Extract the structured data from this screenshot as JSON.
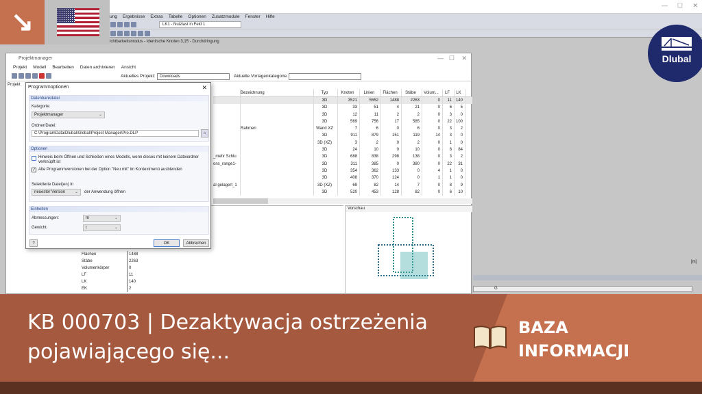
{
  "app": {
    "menu": [
      "ung",
      "Ergebnisse",
      "Extras",
      "Tabelle",
      "Optionen",
      "Zusatzmodule",
      "Fenster",
      "Hilfe"
    ],
    "load_case": "LK1 - Nutzlast in Feld 1",
    "status": "ichtbarkeitsmodus - Identische Knoten 3,15 - Durchdringung",
    "unit": "[m]",
    "bottom_tab": "G"
  },
  "pm": {
    "title": "Projektmanager",
    "menu": [
      "Projekt",
      "Modell",
      "Bearbeiten",
      "Daten archivieren",
      "Ansicht"
    ],
    "current_project_label": "Aktuelles Projekt:",
    "current_project": "Downloads",
    "template_label": "Aktuelle Vorlagenkategorie",
    "template_value": "",
    "left_tab": "Projekt",
    "table": {
      "headers": [
        "",
        "Bezeichnung",
        "Typ",
        "Knoten",
        "Linien",
        "Flächen",
        "Stäbe",
        "Volum...",
        "LF",
        "LK"
      ],
      "rows": [
        [
          "",
          "",
          "3D",
          "3521",
          "5552",
          "1488",
          "2263",
          "0",
          "11",
          "140"
        ],
        [
          "",
          "",
          "3D",
          "33",
          "51",
          "4",
          "21",
          "0",
          "6",
          "5"
        ],
        [
          "",
          "",
          "3D",
          "12",
          "11",
          "2",
          "2",
          "0",
          "3",
          "0"
        ],
        [
          "",
          "",
          "3D",
          "569",
          "756",
          "17",
          "585",
          "0",
          "22",
          "100"
        ],
        [
          "",
          "Rahmen",
          "Wand XZ",
          "7",
          "6",
          "0",
          "6",
          "0",
          "3",
          "2"
        ],
        [
          "",
          "",
          "3D",
          "911",
          "879",
          "151",
          "119",
          "14",
          "3",
          "0"
        ],
        [
          "",
          "",
          "3D (XZ)",
          "3",
          "2",
          "0",
          "2",
          "0",
          "1",
          "0"
        ],
        [
          "",
          "",
          "3D",
          "24",
          "10",
          "0",
          "10",
          "0",
          "8",
          "84"
        ],
        [
          "_mehr Schlu",
          "",
          "3D",
          "688",
          "838",
          "298",
          "138",
          "0",
          "3",
          "2"
        ],
        [
          "ons_range1-",
          "",
          "3D",
          "311",
          "385",
          "0",
          "380",
          "0",
          "22",
          "31"
        ],
        [
          "",
          "",
          "3D",
          "354",
          "362",
          "133",
          "0",
          "4",
          "1",
          "0"
        ],
        [
          "",
          "",
          "3D",
          "408",
          "370",
          "124",
          "0",
          "1",
          "1",
          "0"
        ],
        [
          "al gelagert_1",
          "",
          "3D (XZ)",
          "69",
          "82",
          "14",
          "7",
          "0",
          "8",
          "9"
        ],
        [
          "",
          "",
          "3D",
          "520",
          "453",
          "128",
          "82",
          "0",
          "6",
          "10"
        ]
      ]
    },
    "info": [
      [
        "Flächen",
        "1488"
      ],
      [
        "Stäbe",
        "2263"
      ],
      [
        "Volumenkörper",
        "0"
      ],
      [
        "LF",
        "11"
      ],
      [
        "LK",
        "140"
      ],
      [
        "EK",
        "2"
      ]
    ],
    "preview_title": "Vorschau"
  },
  "dialog": {
    "title": "Programmoptionen",
    "g1": "Datenbankdatei",
    "kategorie_label": "Kategorie:",
    "kategorie": "Projektmanager",
    "ordner_label": "Ordner/Datei:",
    "ordner": "C:\\ProgramData\\Dlubal\\Global\\Project Manager\\Pro.DLP",
    "g2": "Optionen",
    "opt1": "Hinweis beim Öffnen und Schließen eines Modells, wenn dieses mit keinem Dateiordner verknüpft ist",
    "opt1_checked": false,
    "opt2": "Alte Programmversionen bei der Option \"Neu mit\" im Kontextmenü ausblenden",
    "opt2_checked": true,
    "sel_label": "Selektierte Datei(en) in",
    "version": "neuester Version",
    "version_suffix": "der Anwendung öffnen",
    "g3": "Einheiten",
    "abm_label": "Abmessungen:",
    "abm": "m",
    "gew_label": "Gewicht:",
    "gew": "t",
    "ok": "OK",
    "cancel": "Abbrechen"
  },
  "banner": {
    "title": "KB 000703 | Dezaktywacja ostrzeżenia pojawiającego się...",
    "category_line1": "BAZA",
    "category_line2": "INFORMACJI",
    "logo": "Dlubal"
  },
  "colors": {
    "accent": "#c5714f",
    "banner": "#a5593f",
    "dlubal": "#1f2a6c"
  }
}
